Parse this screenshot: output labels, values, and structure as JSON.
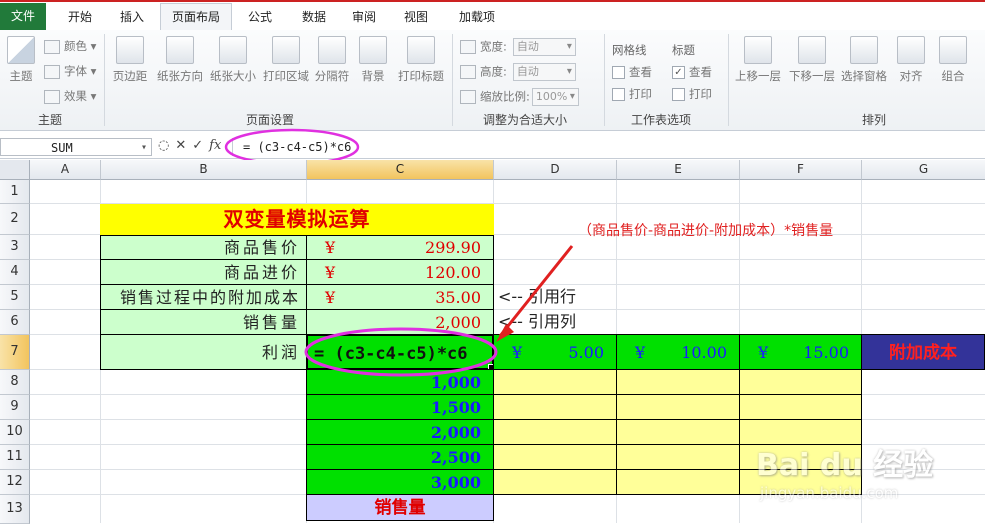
{
  "ribbon": {
    "tabs": [
      "文件",
      "开始",
      "插入",
      "页面布局",
      "公式",
      "数据",
      "审阅",
      "视图",
      "加载项"
    ],
    "groups": {
      "theme": {
        "label": "主题",
        "main": "主题",
        "colors": "颜色",
        "fonts": "字体",
        "effects": "效果"
      },
      "page_setup": {
        "label": "页面设置",
        "buttons": [
          "页边距",
          "纸张方向",
          "纸张大小",
          "打印区域",
          "分隔符",
          "背景",
          "打印标题"
        ]
      },
      "scale": {
        "label": "调整为合适大小",
        "width_label": "宽度:",
        "width_value": "自动",
        "height_label": "高度:",
        "height_value": "自动",
        "scale_label": "缩放比例:",
        "scale_value": "100%"
      },
      "sheet_options": {
        "label": "工作表选项",
        "gridlines": "网格线",
        "headings": "标题",
        "view": "查看",
        "print": "打印"
      },
      "arrange": {
        "label": "排列",
        "buttons": [
          "上移一层",
          "下移一层",
          "选择窗格",
          "对齐",
          "组合"
        ]
      }
    }
  },
  "formula_bar": {
    "name_box": "SUM",
    "fx": "fx",
    "formula": "= (c3-c4-c5)*c6"
  },
  "sheet": {
    "columns": [
      "A",
      "B",
      "C",
      "D",
      "E",
      "F",
      "G"
    ],
    "rows": [
      "1",
      "2",
      "3",
      "4",
      "5",
      "6",
      "7",
      "8",
      "9",
      "10",
      "11",
      "12",
      "13"
    ],
    "title": "双变量模拟运算",
    "labels": [
      "商品售价",
      "商品进价",
      "销售过程中的附加成本",
      "销售量",
      "利润"
    ],
    "currency": "¥",
    "values": [
      "299.90",
      "120.00",
      "35.00",
      "2,000"
    ],
    "ref_row": "<-- 引用行",
    "ref_col": "<-- 引用列",
    "c7_formula": "= (c3-c4-c5)*c6",
    "header_row": [
      {
        "cur": "¥",
        "val": "5.00"
      },
      {
        "cur": "¥",
        "val": "10.00"
      },
      {
        "cur": "¥",
        "val": "15.00"
      }
    ],
    "add_cost_label": "附加成本",
    "col_values": [
      "1,000",
      "1,500",
      "2,000",
      "2,500",
      "3,000"
    ],
    "sales_label": "销售量",
    "annotation": "（商品售价-商品进价-附加成本）*销售量"
  },
  "watermark": {
    "brand": "Bai du 经验",
    "url": "jingyan.baidu.com"
  }
}
